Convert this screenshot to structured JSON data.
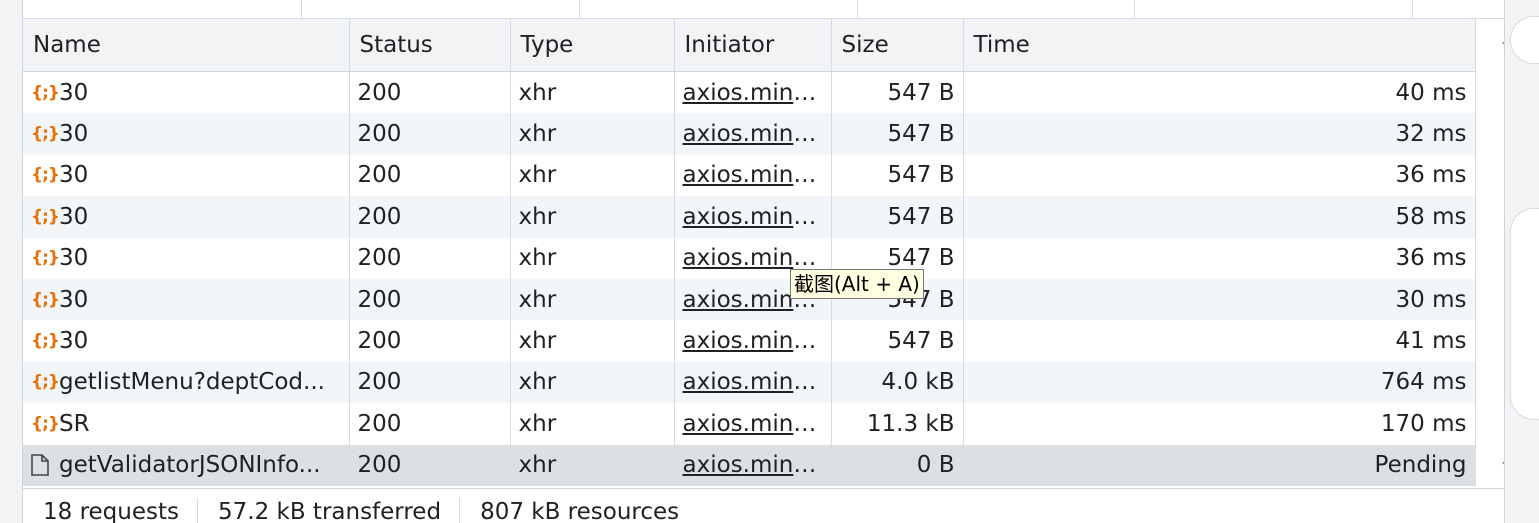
{
  "columns": {
    "name": "Name",
    "status": "Status",
    "type": "Type",
    "initiator": "Initiator",
    "size": "Size",
    "time": "Time"
  },
  "rows": [
    {
      "icon": "xhr-icon",
      "name": "30",
      "status": "200",
      "type": "xhr",
      "initiator": "axios.min.js?t",
      "size": "547 B",
      "time": "40 ms"
    },
    {
      "icon": "xhr-icon",
      "name": "30",
      "status": "200",
      "type": "xhr",
      "initiator": "axios.min.js?t",
      "size": "547 B",
      "time": "32 ms"
    },
    {
      "icon": "xhr-icon",
      "name": "30",
      "status": "200",
      "type": "xhr",
      "initiator": "axios.min.js?t",
      "size": "547 B",
      "time": "36 ms"
    },
    {
      "icon": "xhr-icon",
      "name": "30",
      "status": "200",
      "type": "xhr",
      "initiator": "axios.min.js?t",
      "size": "547 B",
      "time": "58 ms"
    },
    {
      "icon": "xhr-icon",
      "name": "30",
      "status": "200",
      "type": "xhr",
      "initiator": "axios.min.js?t",
      "size": "547 B",
      "time": "36 ms"
    },
    {
      "icon": "xhr-icon",
      "name": "30",
      "status": "200",
      "type": "xhr",
      "initiator": "axios.min.js?t",
      "size": "547 B",
      "time": "30 ms"
    },
    {
      "icon": "xhr-icon",
      "name": "30",
      "status": "200",
      "type": "xhr",
      "initiator": "axios.min.js?t",
      "size": "547 B",
      "time": "41 ms"
    },
    {
      "icon": "xhr-icon",
      "name": "getlistMenu?deptCod...",
      "status": "200",
      "type": "xhr",
      "initiator": "axios.min.js?t",
      "size": "4.0 kB",
      "time": "764 ms"
    },
    {
      "icon": "xhr-icon",
      "name": "SR",
      "status": "200",
      "type": "xhr",
      "initiator": "axios.min.js?t",
      "size": "11.3 kB",
      "time": "170 ms"
    },
    {
      "icon": "document-icon",
      "name": "getValidatorJSONInfo...",
      "status": "200",
      "type": "xhr",
      "initiator": "axios.min.js?t",
      "size": "0 B",
      "time": "Pending",
      "selected": true
    }
  ],
  "tooltip": "截图(Alt + A)",
  "status_bar": {
    "requests": "18 requests",
    "transferred": "57.2 kB transferred",
    "resources": "807 kB resources"
  },
  "colors": {
    "xhr_icon": "#e8710a",
    "header_bg": "#f1f3f4",
    "selected_row": "#dde0e3",
    "tooltip_bg": "#ffffe1"
  }
}
